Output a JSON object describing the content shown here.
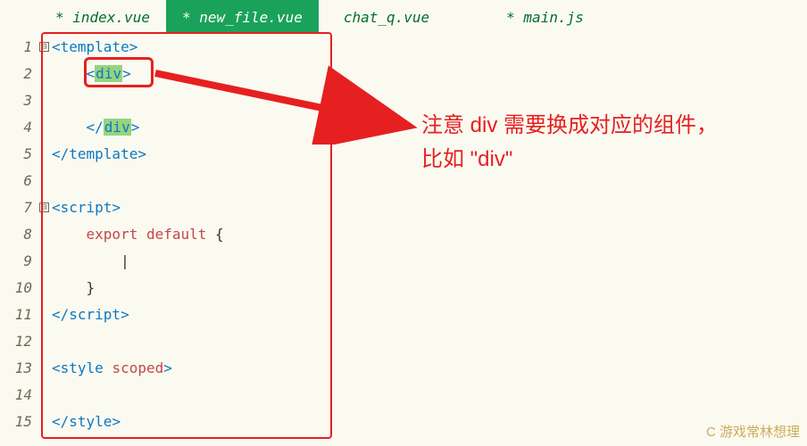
{
  "tabs": [
    {
      "label": "* index.vue",
      "active": false
    },
    {
      "label": "* new_file.vue",
      "active": true
    },
    {
      "label": "chat_q.vue",
      "active": false
    },
    {
      "label": "* main.js",
      "active": false
    }
  ],
  "gutter": {
    "start": 1,
    "end": 15
  },
  "fold_markers": [
    {
      "line": 1,
      "symbol": "⊟"
    },
    {
      "line": 7,
      "symbol": "⊟"
    }
  ],
  "code": {
    "l1": {
      "open": "<",
      "tag": "template",
      "close": ">"
    },
    "l2": {
      "indent": "    ",
      "open": "<",
      "tag": "div",
      "close": ">"
    },
    "l3": {
      "text": ""
    },
    "l4": {
      "indent": "    ",
      "open": "</",
      "tag": "div",
      "close": ">"
    },
    "l5": {
      "open": "</",
      "tag": "template",
      "close": ">"
    },
    "l6": {
      "text": ""
    },
    "l7": {
      "open": "<",
      "tag": "script",
      "close": ">"
    },
    "l8": {
      "indent": "    ",
      "kw1": "export",
      "sp": " ",
      "kw2": "default",
      "rest": " {"
    },
    "l9": {
      "indent": "        ",
      "cursor": "|"
    },
    "l10": {
      "indent": "    ",
      "text": "}"
    },
    "l11": {
      "open": "</",
      "tag": "script",
      "close": ">"
    },
    "l12": {
      "text": ""
    },
    "l13": {
      "open": "<",
      "tag": "style",
      "sp": " ",
      "attr": "scoped",
      "close": ">"
    },
    "l14": {
      "text": ""
    },
    "l15": {
      "open": "</",
      "tag": "style",
      "close": ">"
    }
  },
  "annotation": {
    "line1": "注意 div 需要换成对应的组件，",
    "line2": "比如 \"div\""
  },
  "watermark": "C 游戏常林想理",
  "colors": {
    "accent_red": "#e62020",
    "tab_active": "#1aa25a",
    "highlight": "#96d47e"
  }
}
